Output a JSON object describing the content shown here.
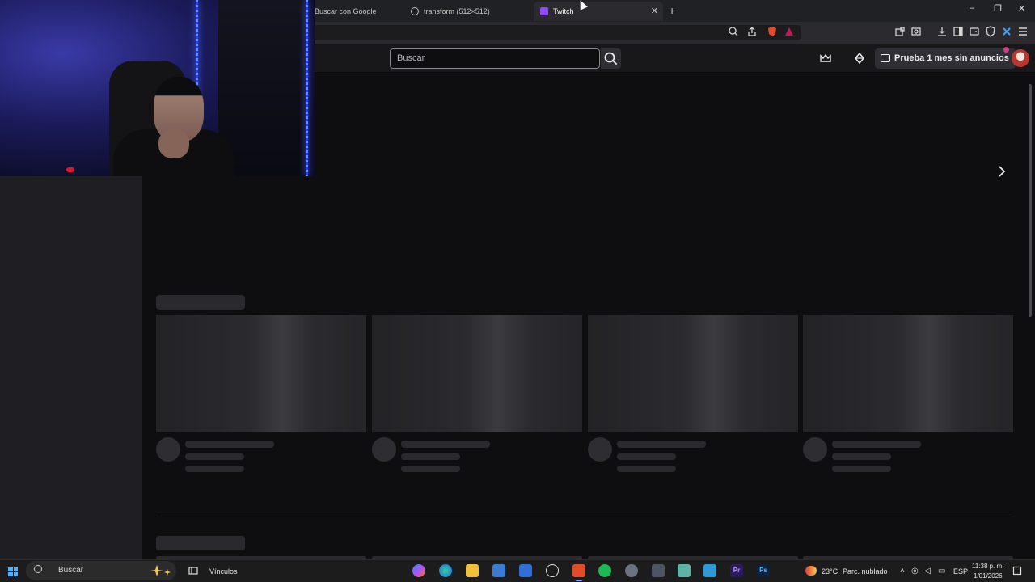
{
  "browser": {
    "tabs": [
      {
        "label": "Buscar con Google",
        "icon": "none",
        "active": false
      },
      {
        "label": "transform (512×512)",
        "icon": "globe-icon",
        "active": false
      },
      {
        "label": "Twitch",
        "icon": "twitch-icon",
        "active": true
      }
    ],
    "close_glyph": "✕",
    "new_tab_glyph": "+",
    "window_controls": {
      "minimize": "–",
      "maximize": "❐",
      "close": "✕"
    }
  },
  "twitch": {
    "search": {
      "placeholder": "Buscar"
    },
    "prime_button_label": "Prueba 1 mes sin anuncios",
    "carousel_next_glyph": "›",
    "accent": "#9147ff"
  },
  "taskbar": {
    "search_label": "Buscar",
    "vinculos_label": "Vínculos",
    "weather": {
      "temp": "23°C",
      "condition": "Parc. nublado"
    },
    "language": "ESP",
    "time": "11:38 p. m.",
    "date": "1/01/2026"
  }
}
